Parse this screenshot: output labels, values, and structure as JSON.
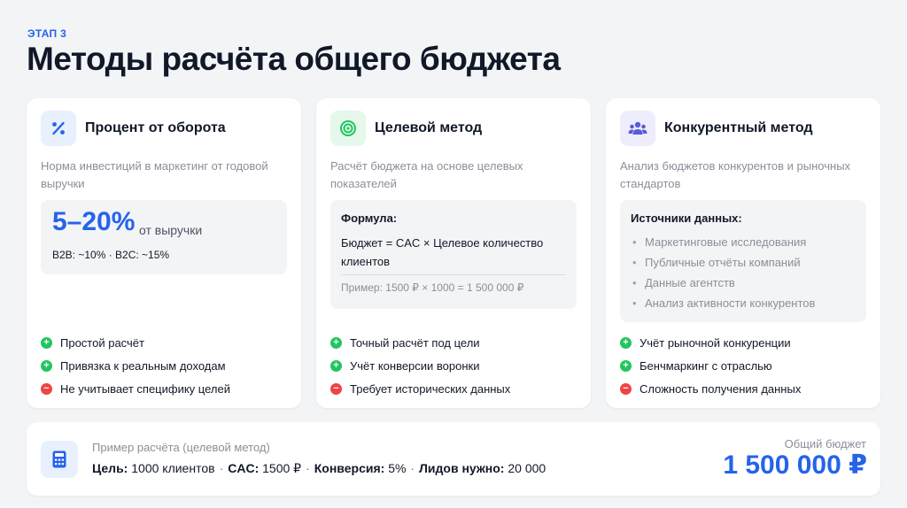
{
  "header": {
    "stage": "ЭТАП 3",
    "title": "Методы расчёта общего бюджета"
  },
  "colors": {
    "accent": "#2563eb",
    "plus": "#22c55e",
    "minus": "#ef4444"
  },
  "cards": [
    {
      "icon": "percent-icon",
      "title": "Процент от оборота",
      "description": "Норма инвестиций в маркетинг от годовой выручки",
      "highlight": {
        "value": "5–20%",
        "suffix": "от выручки",
        "detail": "B2B: ~10% · B2C: ~15%"
      },
      "points": [
        {
          "type": "plus",
          "text": "Простой расчёт"
        },
        {
          "type": "plus",
          "text": "Привязка к реальным доходам"
        },
        {
          "type": "minus",
          "text": "Не учитывает специфику целей"
        }
      ]
    },
    {
      "icon": "target-icon",
      "title": "Целевой метод",
      "description": "Расчёт бюджета на основе целевых показателей",
      "formula": {
        "label": "Формула:",
        "text": "Бюджет = CAC × Целевое количество клиентов",
        "example": "Пример: 1500 ₽ × 1000 = 1 500 000 ₽"
      },
      "points": [
        {
          "type": "plus",
          "text": "Точный расчёт под цели"
        },
        {
          "type": "plus",
          "text": "Учёт конверсии воронки"
        },
        {
          "type": "minus",
          "text": "Требует исторических данных"
        }
      ]
    },
    {
      "icon": "users-icon",
      "title": "Конкурентный метод",
      "description": "Анализ бюджетов конкурентов и рыночных стандартов",
      "sources": {
        "label": "Источники данных:",
        "items": [
          "Маркетинговые исследования",
          "Публичные отчёты компаний",
          "Данные агентств",
          "Анализ активности конкурентов"
        ]
      },
      "points": [
        {
          "type": "plus",
          "text": "Учёт рыночной конкуренции"
        },
        {
          "type": "plus",
          "text": "Бенчмаркинг с отраслью"
        },
        {
          "type": "minus",
          "text": "Сложность получения данных"
        }
      ]
    }
  ],
  "example": {
    "icon": "calculator-icon",
    "title": "Пример расчёта (целевой метод)",
    "goal_label": "Цель:",
    "goal_value": "1000 клиентов",
    "cac_label": "CAC:",
    "cac_value": "1500 ₽",
    "conv_label": "Конверсия:",
    "conv_value": "5%",
    "leads_label": "Лидов нужно:",
    "leads_value": "20 000",
    "total_label": "Общий бюджет",
    "total_value": "1 500 000 ₽"
  }
}
